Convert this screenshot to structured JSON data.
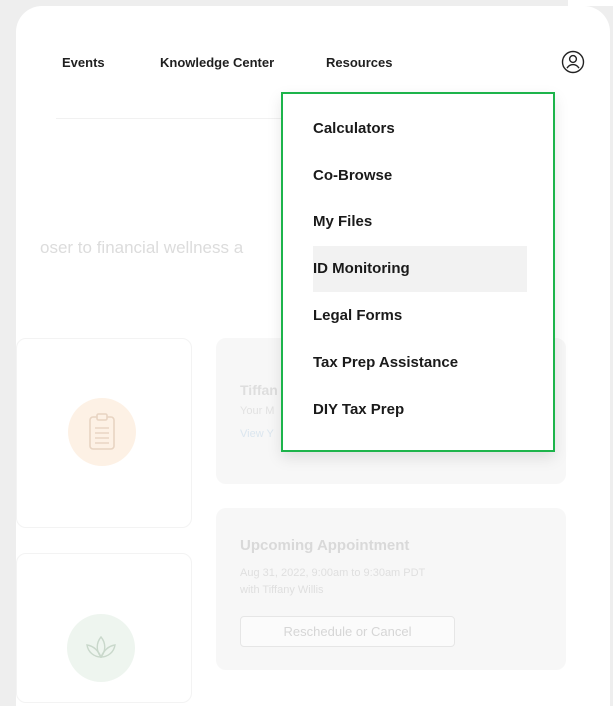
{
  "nav": {
    "events": "Events",
    "knowledge_center": "Knowledge Center",
    "resources": "Resources",
    "user_icon": "user-circle-icon"
  },
  "hero": {
    "tagline_fragment": "oser to financial wellness a"
  },
  "cards": {
    "tiffany": {
      "title": "Tiffan",
      "subtitle": "Your M",
      "link": "View Y"
    },
    "appointment": {
      "title": "Upcoming Appointment",
      "datetime": "Aug 31, 2022, 9:00am to 9:30am PDT",
      "with": "with Tiffany Willis",
      "button": "Reschedule or Cancel"
    },
    "icons": [
      "clipboard-icon",
      "lotus-icon"
    ]
  },
  "dropdown": {
    "items": [
      {
        "label": "Calculators"
      },
      {
        "label": "Co-Browse"
      },
      {
        "label": "My Files"
      },
      {
        "label": "ID Monitoring",
        "hovered": true
      },
      {
        "label": "Legal Forms"
      },
      {
        "label": "Tax Prep Assistance"
      },
      {
        "label": "DIY Tax Prep"
      }
    ],
    "border_color": "#1db44b"
  },
  "colors": {
    "clipboard_circle": "#fdf1e5",
    "lotus_circle": "#eef5ef"
  }
}
